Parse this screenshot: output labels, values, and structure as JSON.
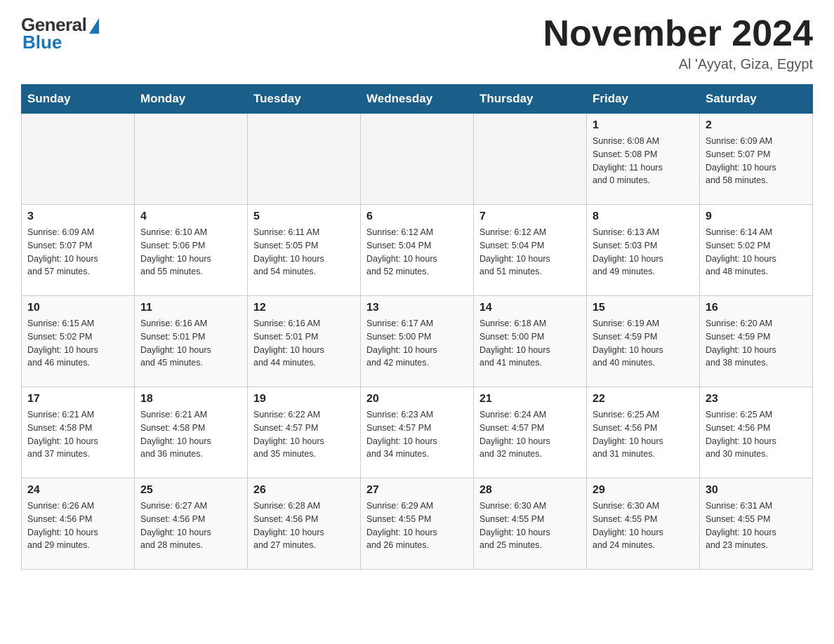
{
  "header": {
    "logo_general": "General",
    "logo_blue": "Blue",
    "title": "November 2024",
    "subtitle": "Al 'Ayyat, Giza, Egypt"
  },
  "days_of_week": [
    "Sunday",
    "Monday",
    "Tuesday",
    "Wednesday",
    "Thursday",
    "Friday",
    "Saturday"
  ],
  "weeks": [
    [
      {
        "day": "",
        "info": ""
      },
      {
        "day": "",
        "info": ""
      },
      {
        "day": "",
        "info": ""
      },
      {
        "day": "",
        "info": ""
      },
      {
        "day": "",
        "info": ""
      },
      {
        "day": "1",
        "info": "Sunrise: 6:08 AM\nSunset: 5:08 PM\nDaylight: 11 hours\nand 0 minutes."
      },
      {
        "day": "2",
        "info": "Sunrise: 6:09 AM\nSunset: 5:07 PM\nDaylight: 10 hours\nand 58 minutes."
      }
    ],
    [
      {
        "day": "3",
        "info": "Sunrise: 6:09 AM\nSunset: 5:07 PM\nDaylight: 10 hours\nand 57 minutes."
      },
      {
        "day": "4",
        "info": "Sunrise: 6:10 AM\nSunset: 5:06 PM\nDaylight: 10 hours\nand 55 minutes."
      },
      {
        "day": "5",
        "info": "Sunrise: 6:11 AM\nSunset: 5:05 PM\nDaylight: 10 hours\nand 54 minutes."
      },
      {
        "day": "6",
        "info": "Sunrise: 6:12 AM\nSunset: 5:04 PM\nDaylight: 10 hours\nand 52 minutes."
      },
      {
        "day": "7",
        "info": "Sunrise: 6:12 AM\nSunset: 5:04 PM\nDaylight: 10 hours\nand 51 minutes."
      },
      {
        "day": "8",
        "info": "Sunrise: 6:13 AM\nSunset: 5:03 PM\nDaylight: 10 hours\nand 49 minutes."
      },
      {
        "day": "9",
        "info": "Sunrise: 6:14 AM\nSunset: 5:02 PM\nDaylight: 10 hours\nand 48 minutes."
      }
    ],
    [
      {
        "day": "10",
        "info": "Sunrise: 6:15 AM\nSunset: 5:02 PM\nDaylight: 10 hours\nand 46 minutes."
      },
      {
        "day": "11",
        "info": "Sunrise: 6:16 AM\nSunset: 5:01 PM\nDaylight: 10 hours\nand 45 minutes."
      },
      {
        "day": "12",
        "info": "Sunrise: 6:16 AM\nSunset: 5:01 PM\nDaylight: 10 hours\nand 44 minutes."
      },
      {
        "day": "13",
        "info": "Sunrise: 6:17 AM\nSunset: 5:00 PM\nDaylight: 10 hours\nand 42 minutes."
      },
      {
        "day": "14",
        "info": "Sunrise: 6:18 AM\nSunset: 5:00 PM\nDaylight: 10 hours\nand 41 minutes."
      },
      {
        "day": "15",
        "info": "Sunrise: 6:19 AM\nSunset: 4:59 PM\nDaylight: 10 hours\nand 40 minutes."
      },
      {
        "day": "16",
        "info": "Sunrise: 6:20 AM\nSunset: 4:59 PM\nDaylight: 10 hours\nand 38 minutes."
      }
    ],
    [
      {
        "day": "17",
        "info": "Sunrise: 6:21 AM\nSunset: 4:58 PM\nDaylight: 10 hours\nand 37 minutes."
      },
      {
        "day": "18",
        "info": "Sunrise: 6:21 AM\nSunset: 4:58 PM\nDaylight: 10 hours\nand 36 minutes."
      },
      {
        "day": "19",
        "info": "Sunrise: 6:22 AM\nSunset: 4:57 PM\nDaylight: 10 hours\nand 35 minutes."
      },
      {
        "day": "20",
        "info": "Sunrise: 6:23 AM\nSunset: 4:57 PM\nDaylight: 10 hours\nand 34 minutes."
      },
      {
        "day": "21",
        "info": "Sunrise: 6:24 AM\nSunset: 4:57 PM\nDaylight: 10 hours\nand 32 minutes."
      },
      {
        "day": "22",
        "info": "Sunrise: 6:25 AM\nSunset: 4:56 PM\nDaylight: 10 hours\nand 31 minutes."
      },
      {
        "day": "23",
        "info": "Sunrise: 6:25 AM\nSunset: 4:56 PM\nDaylight: 10 hours\nand 30 minutes."
      }
    ],
    [
      {
        "day": "24",
        "info": "Sunrise: 6:26 AM\nSunset: 4:56 PM\nDaylight: 10 hours\nand 29 minutes."
      },
      {
        "day": "25",
        "info": "Sunrise: 6:27 AM\nSunset: 4:56 PM\nDaylight: 10 hours\nand 28 minutes."
      },
      {
        "day": "26",
        "info": "Sunrise: 6:28 AM\nSunset: 4:56 PM\nDaylight: 10 hours\nand 27 minutes."
      },
      {
        "day": "27",
        "info": "Sunrise: 6:29 AM\nSunset: 4:55 PM\nDaylight: 10 hours\nand 26 minutes."
      },
      {
        "day": "28",
        "info": "Sunrise: 6:30 AM\nSunset: 4:55 PM\nDaylight: 10 hours\nand 25 minutes."
      },
      {
        "day": "29",
        "info": "Sunrise: 6:30 AM\nSunset: 4:55 PM\nDaylight: 10 hours\nand 24 minutes."
      },
      {
        "day": "30",
        "info": "Sunrise: 6:31 AM\nSunset: 4:55 PM\nDaylight: 10 hours\nand 23 minutes."
      }
    ]
  ]
}
